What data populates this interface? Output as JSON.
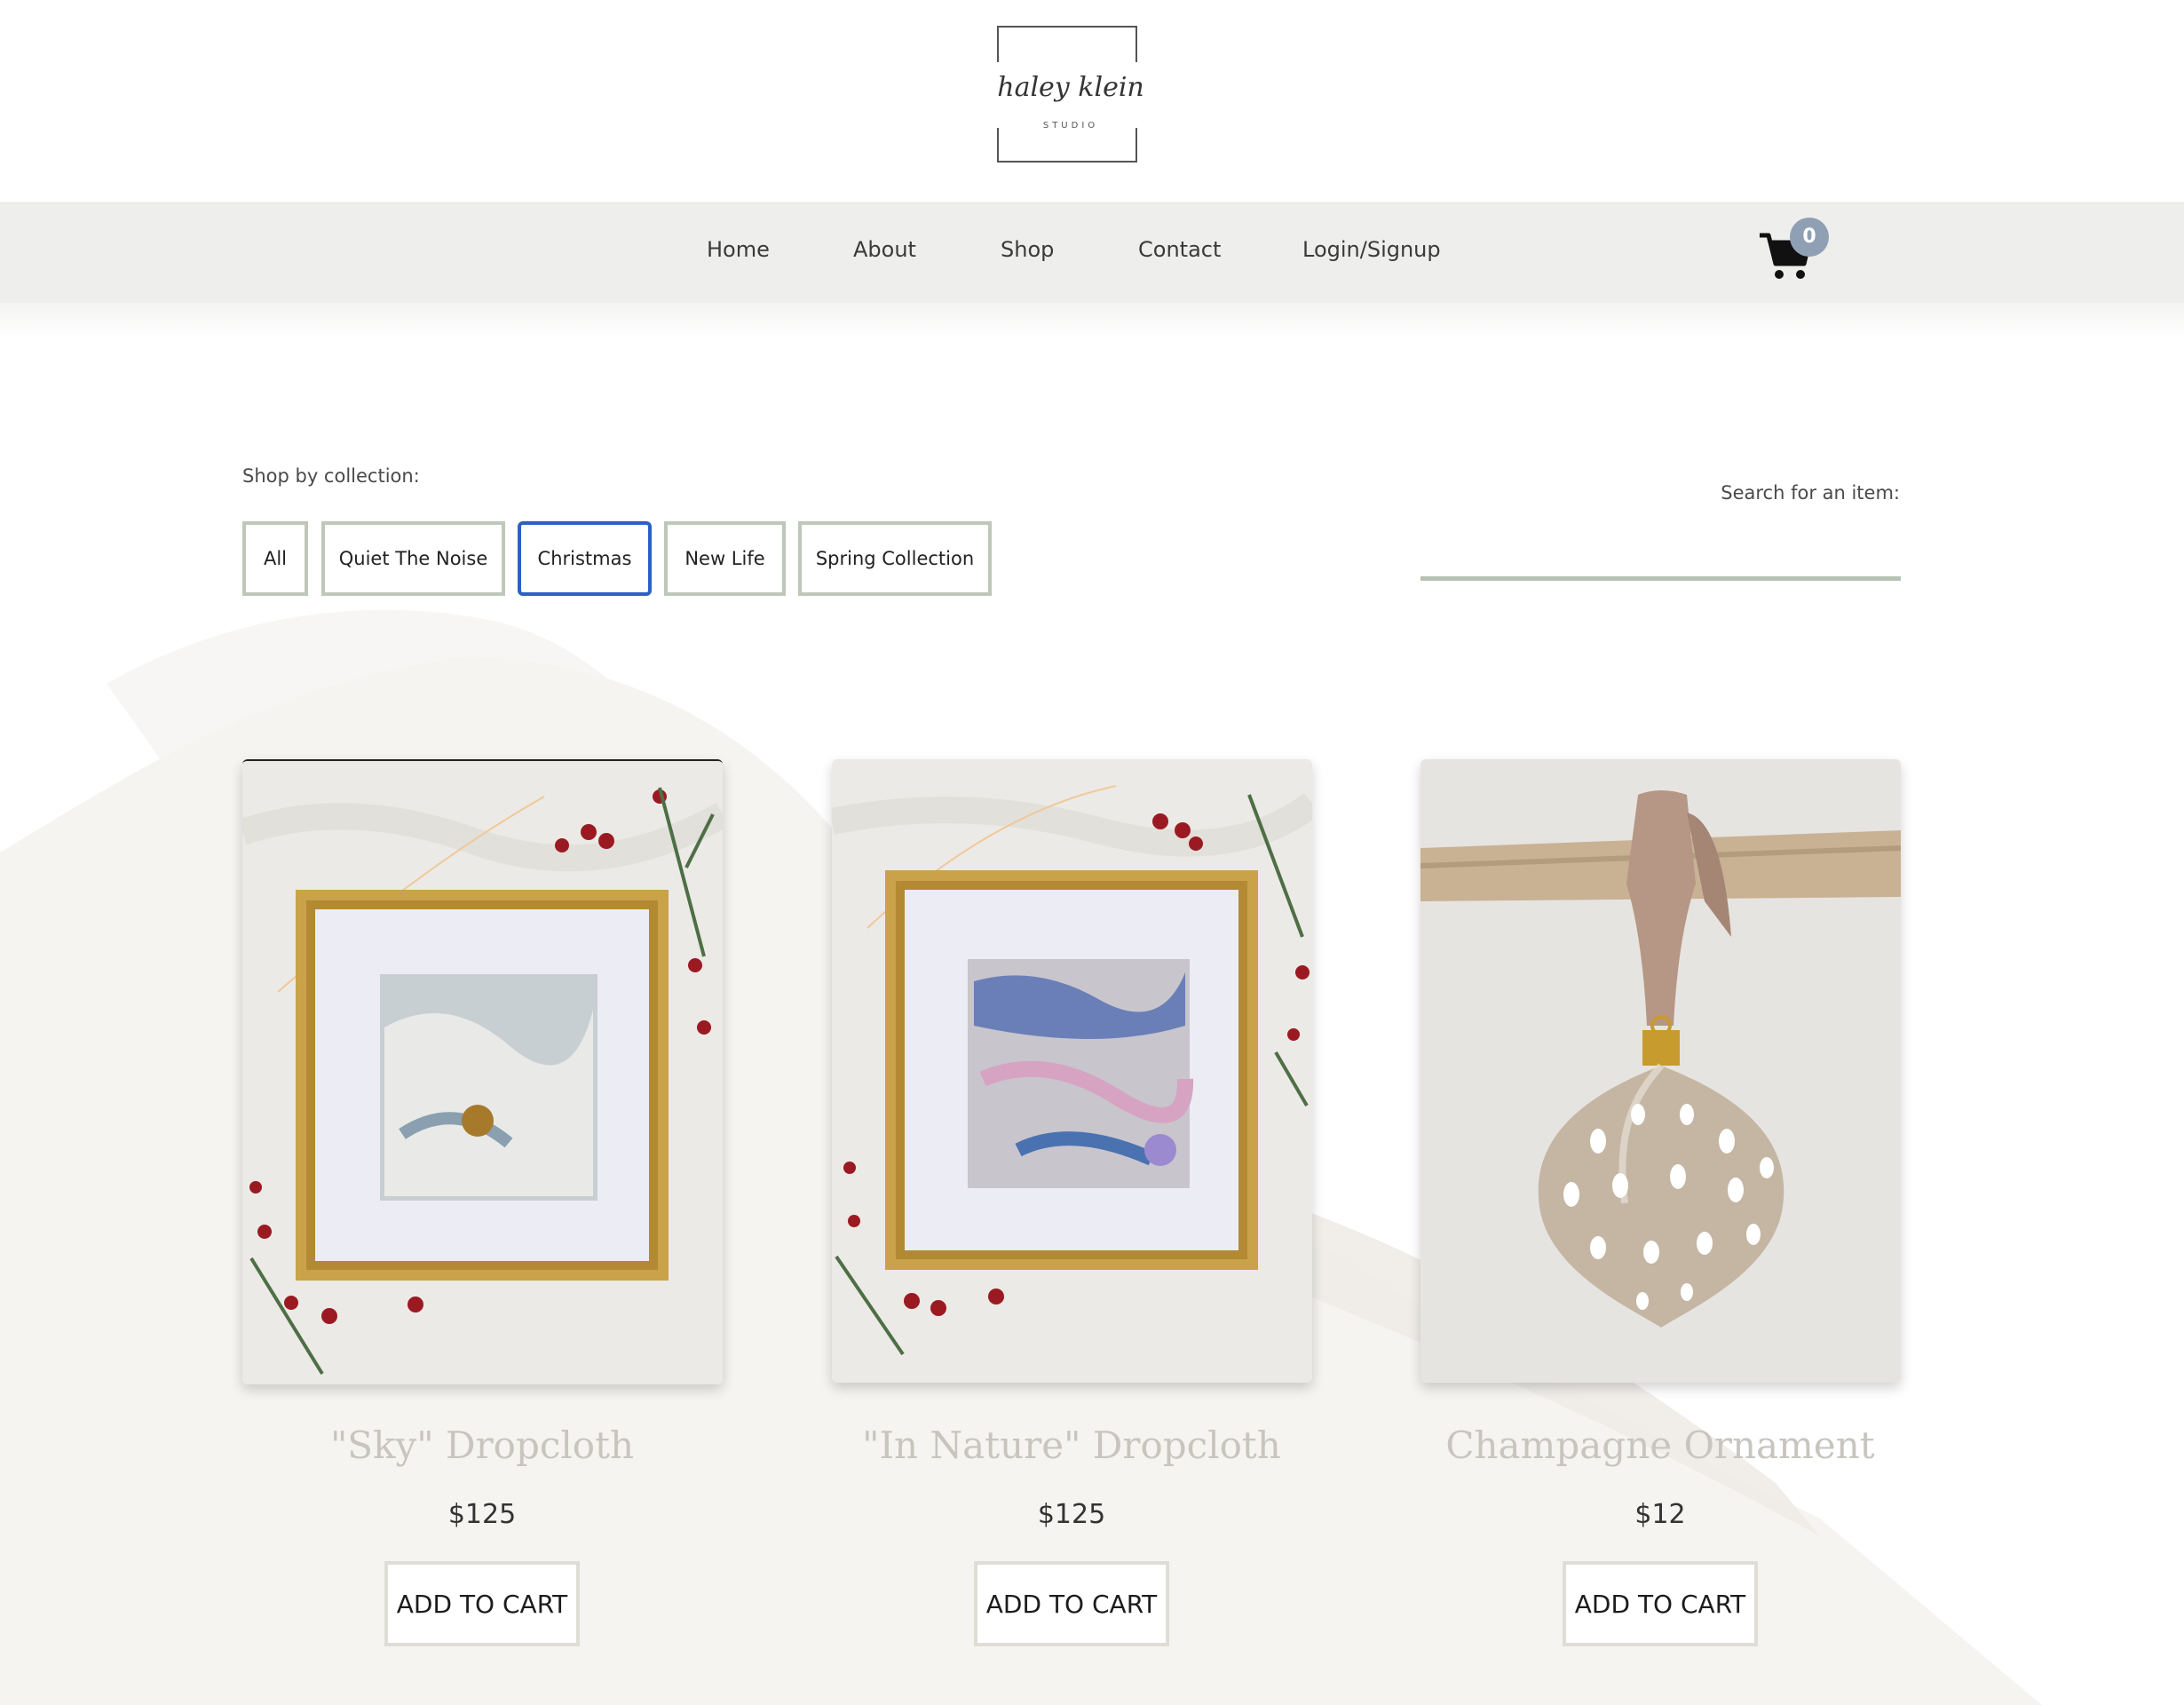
{
  "brand": {
    "logo_script": "haley klein",
    "logo_sub": "STUDIO"
  },
  "nav": {
    "items": [
      {
        "label": "Home"
      },
      {
        "label": "About"
      },
      {
        "label": "Shop"
      },
      {
        "label": "Contact"
      },
      {
        "label": "Login/Signup"
      }
    ],
    "cart_icon": "shopping-cart-icon",
    "cart_count": "0",
    "badge_color": "#8fa0b4"
  },
  "shop": {
    "collection_label": "Shop by collection:",
    "collections": [
      {
        "label": "All",
        "active": false
      },
      {
        "label": "Quiet The Noise",
        "active": false
      },
      {
        "label": "Christmas",
        "active": true
      },
      {
        "label": "New Life",
        "active": false
      },
      {
        "label": "Spring Collection",
        "active": false
      }
    ],
    "search_label": "Search for an item:",
    "search_value": ""
  },
  "products": [
    {
      "title": "\"Sky\" Dropcloth",
      "price": "$125",
      "cta": "ADD TO CART"
    },
    {
      "title": "\"In Nature\" Dropcloth",
      "price": "$125",
      "cta": "ADD TO CART"
    },
    {
      "title": "Champagne Ornament",
      "price": "$12",
      "cta": "ADD TO CART"
    }
  ],
  "colors": {
    "nav_bg": "#eeeeec",
    "active_filter_border": "#2b61c4",
    "filter_border": "#bfc7bb",
    "title_color": "#c8c5bf"
  }
}
